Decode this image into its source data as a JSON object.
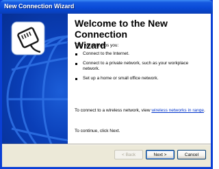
{
  "window": {
    "title": "New Connection Wizard"
  },
  "page": {
    "heading": "Welcome to the New Connection\nWizard",
    "intro": "This wizard helps you:",
    "bullets": [
      "Connect to the Internet.",
      "Connect to a private network, such as your workplace network.",
      "Set up a home or small office network."
    ],
    "wireless_prefix": "To connect to a wireless network, view ",
    "wireless_link": "wireless networks in range",
    "wireless_suffix": ".",
    "continue_text": "To continue, click Next."
  },
  "buttons": {
    "back": "< Back",
    "next": "Next >",
    "cancel": "Cancel"
  },
  "colors": {
    "titlebar": "#0a4bd8",
    "banner": "#0a3fb8",
    "link": "#0033cc",
    "footer": "#ece9d8"
  },
  "icons": {
    "banner": "phone-jack-icon"
  }
}
